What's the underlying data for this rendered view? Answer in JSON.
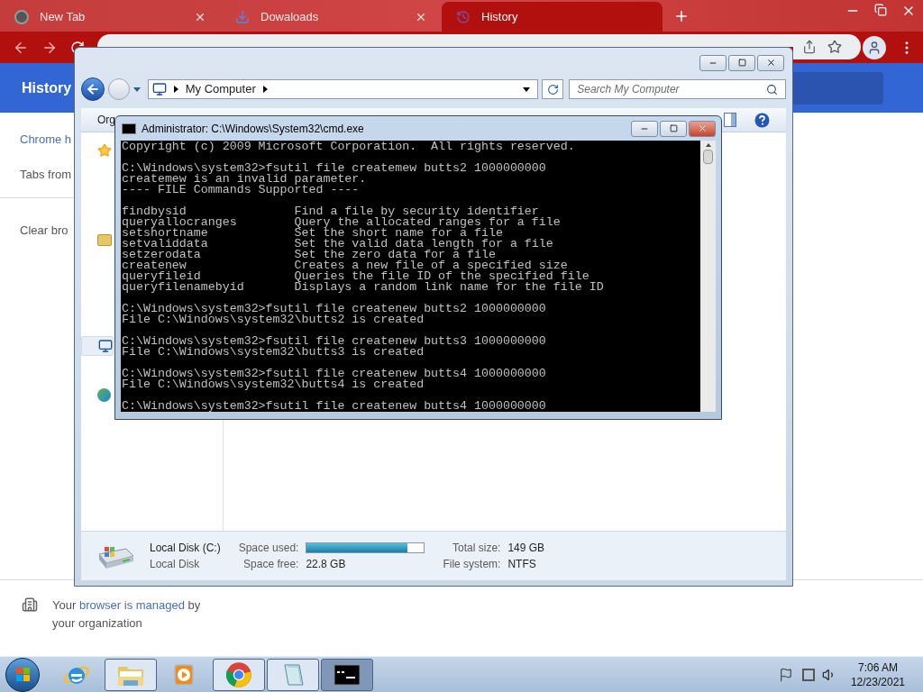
{
  "browser": {
    "tabs": [
      {
        "title": "New Tab",
        "kind": "chrome",
        "selected": false
      },
      {
        "title": "Dowaloads",
        "kind": "download",
        "selected": false
      },
      {
        "title": "History",
        "kind": "history",
        "selected": true
      }
    ],
    "page": {
      "header_title": "History",
      "sidebar_items": [
        {
          "text": "Chrome h",
          "kind": "link"
        },
        {
          "text": "Tabs from",
          "kind": "item"
        },
        {
          "text": "Clear bro",
          "kind": "item"
        }
      ],
      "managed_notice": {
        "before": "Your",
        "link": "browser is managed",
        "after": "by",
        "second_line": "your organization"
      }
    }
  },
  "explorer": {
    "address": {
      "crumbs": [
        "My Computer"
      ]
    },
    "search": {
      "placeholder": "Search My Computer"
    },
    "toolbar": {
      "organize": "Org"
    },
    "details": {
      "drive_name": "Local Disk (C:)",
      "drive_type": "Local Disk",
      "space_used": {
        "label": "Space used:",
        "level": 0.86
      },
      "space_free": {
        "label": "Space free:",
        "value": "22.8 GB"
      },
      "total_size": {
        "label": "Total size:",
        "value": "149 GB"
      },
      "file_system": {
        "label": "File system:",
        "value": "NTFS"
      }
    }
  },
  "console": {
    "title": "Administrator: C:\\Windows\\System32\\cmd.exe",
    "blocks": [
      [
        "Copyright (c) 2009 Microsoft Corporation.  All rights reserved."
      ],
      [
        "C:\\Windows\\system32>fsutil file createmew butts2 1000000000",
        "createmew is an invalid parameter.",
        "---- FILE Commands Supported ----"
      ],
      [
        "findbysid               Find a file by security identifier",
        "queryallocranges        Query the allocated ranges for a file",
        "setshortname            Set the short name for a file",
        "setvaliddata            Set the valid data length for a file",
        "setzerodata             Set the zero data for a file",
        "createnew               Creates a new file of a specified size",
        "queryfileid             Queries the file ID of the specified file",
        "queryfilenamebyid       Displays a random link name for the file ID"
      ],
      [
        "C:\\Windows\\system32>fsutil file createnew butts2 1000000000",
        "File C:\\Windows\\system32\\butts2 is created"
      ],
      [
        "C:\\Windows\\system32>fsutil file createnew butts3 1000000000",
        "File C:\\Windows\\system32\\butts3 is created"
      ],
      [
        "C:\\Windows\\system32>fsutil file createnew butts4 1000000000",
        "File C:\\Windows\\system32\\butts4 is created"
      ],
      [
        "C:\\Windows\\system32>fsutil file createnew butts4 1000000000"
      ]
    ]
  },
  "taskbar": {
    "buttons": [
      {
        "kind": "ie",
        "open": false,
        "selected": false
      },
      {
        "kind": "explorer",
        "open": true,
        "selected": false
      },
      {
        "kind": "media",
        "open": false,
        "selected": false
      },
      {
        "kind": "chrome",
        "open": true,
        "selected": false
      },
      {
        "kind": "notepad",
        "open": true,
        "selected": false
      },
      {
        "kind": "cmd",
        "open": true,
        "selected": true
      }
    ],
    "time": "7:06 AM",
    "date": "12/23/2021"
  }
}
